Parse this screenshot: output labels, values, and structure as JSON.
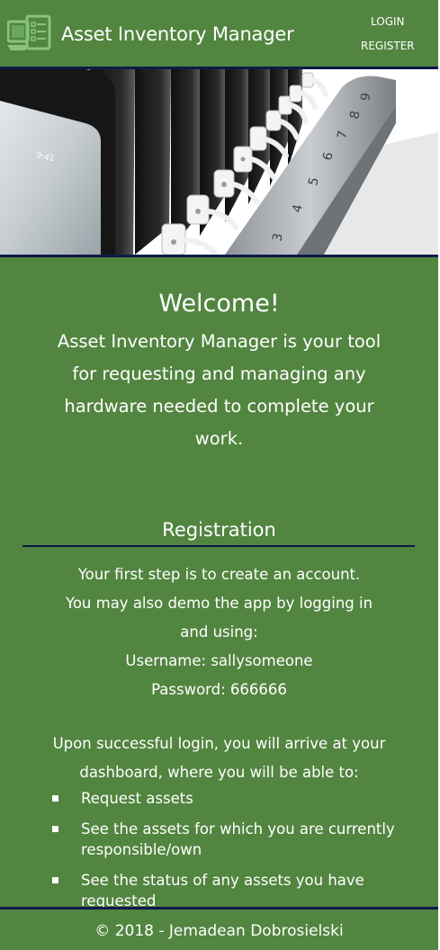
{
  "header": {
    "title": "Asset Inventory Manager",
    "logo_icon": "inventory-checklist-icon",
    "nav": {
      "login": "LOGIN",
      "register": "REGISTER"
    }
  },
  "hero": {
    "image": "tablet-charging-cart-photo",
    "slot_numbers": [
      "3",
      "4",
      "5",
      "6",
      "7",
      "8"
    ]
  },
  "welcome": {
    "title": "Welcome!",
    "text": "Asset Inventory Manager is your tool for requesting and managing any hardware needed to complete your work."
  },
  "registration": {
    "title": "Registration",
    "intro_prefix": "Your first step is to ",
    "create_account_link": "create an account",
    "intro_suffix": ".",
    "demo_prefix": "You may also demo the app by ",
    "login_link": "logging in",
    "demo_suffix": "and using:",
    "username_line": "Username: sallysomeone",
    "password_line": "Password: 666666",
    "dashboard_text": "Upon successful login, you will arrive at your dashboard, where you will be able to:",
    "features": [
      "Request assets",
      "See the assets for which you are currently responsible/own",
      "See the status of any assets you have requested"
    ]
  },
  "footer": {
    "text": "© 2018 - Jemadean Dobrosielski"
  },
  "colors": {
    "primary_green": "#528540",
    "rule_navy": "#0e1a4a",
    "text": "#ffffff"
  }
}
